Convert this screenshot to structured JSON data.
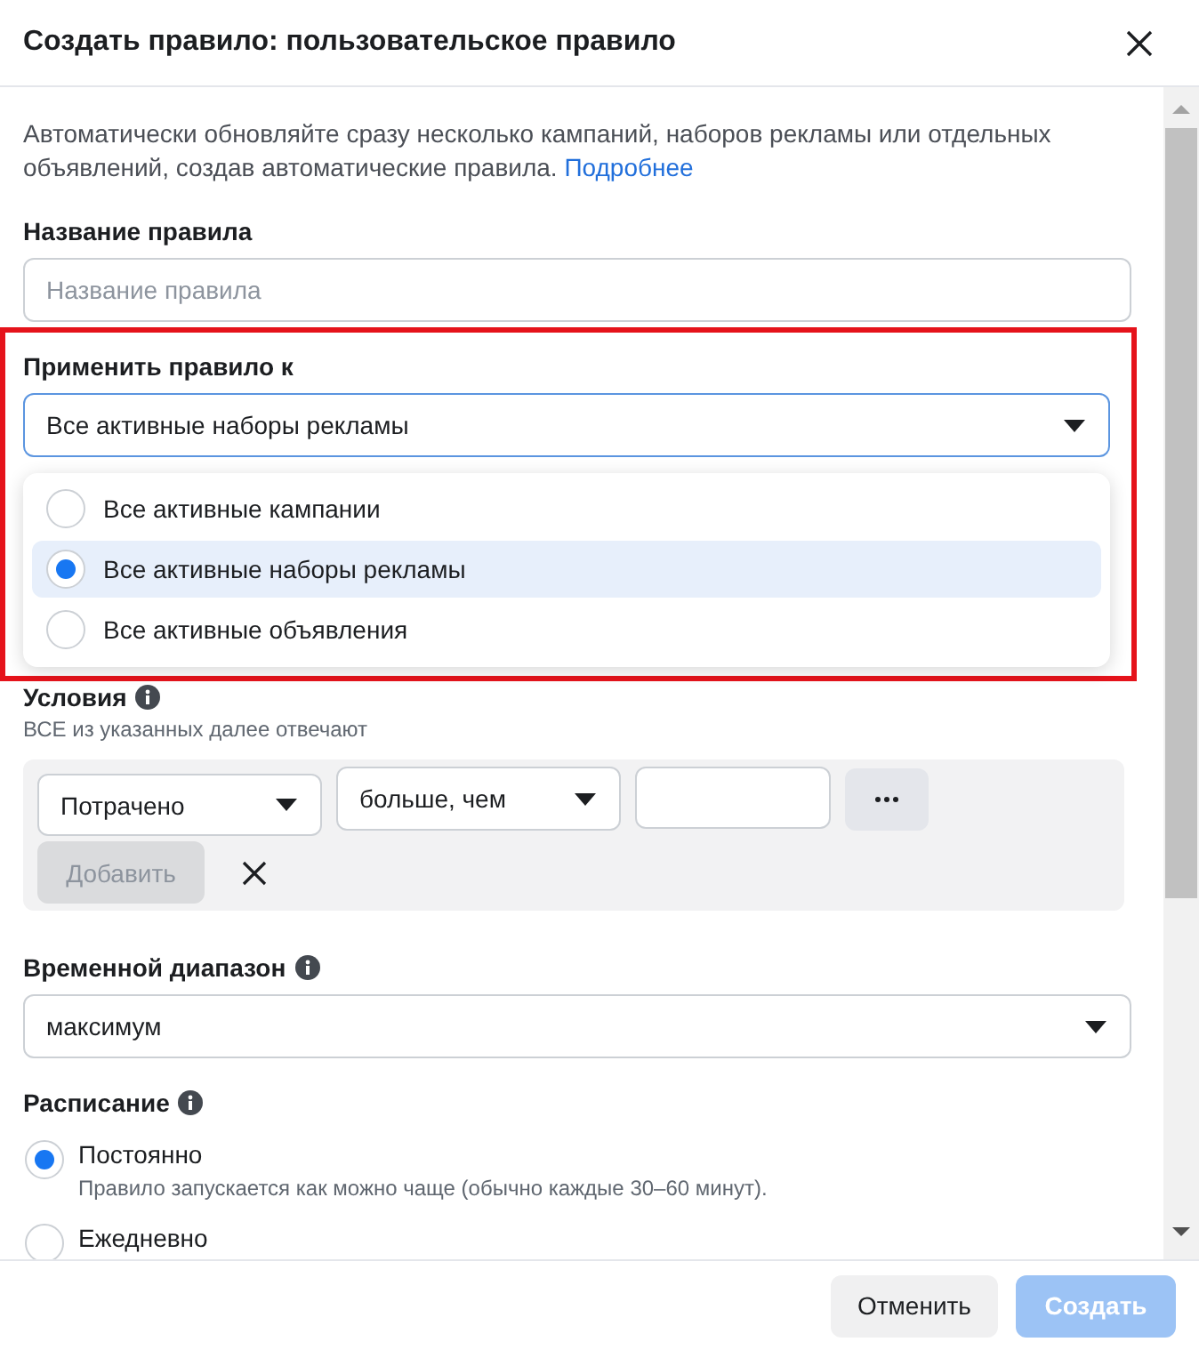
{
  "dialog": {
    "title": "Создать правило: пользовательское правило"
  },
  "intro": {
    "text": "Автоматически обновляйте сразу несколько кампаний, наборов рекламы или отдельных объявлений, создав автоматические правила.",
    "link": "Подробнее"
  },
  "rule_name": {
    "label": "Название правила",
    "placeholder": "Название правила"
  },
  "apply_to": {
    "label": "Применить правило к",
    "value": "Все активные наборы рекламы",
    "focused": true,
    "expanded": true,
    "highlighted": true,
    "options": [
      {
        "label": "Все активные кампании",
        "selected": false
      },
      {
        "label": "Все активные наборы рекламы",
        "selected": true
      },
      {
        "label": "Все активные объявления",
        "selected": false
      }
    ]
  },
  "conditions": {
    "label": "Условия",
    "hint": "ВСЕ из указанных далее отвечают",
    "metric": "Потрачено",
    "operator": "больше, чем",
    "add_button": {
      "label": "Добавить",
      "disabled": true
    }
  },
  "time_range": {
    "label": "Временной диапазон",
    "value": "максимум"
  },
  "schedule": {
    "label": "Расписание",
    "options": [
      {
        "label": "Постоянно",
        "description": "Правило запускается как можно чаще (обычно каждые 30–60 минут).",
        "selected": true
      },
      {
        "label": "Ежедневно",
        "selected": false
      }
    ]
  },
  "footer": {
    "buttons": [
      {
        "label": "Отменить",
        "kind": "secondary",
        "disabled": false
      },
      {
        "label": "Создать",
        "kind": "primary",
        "disabled": true
      }
    ]
  }
}
